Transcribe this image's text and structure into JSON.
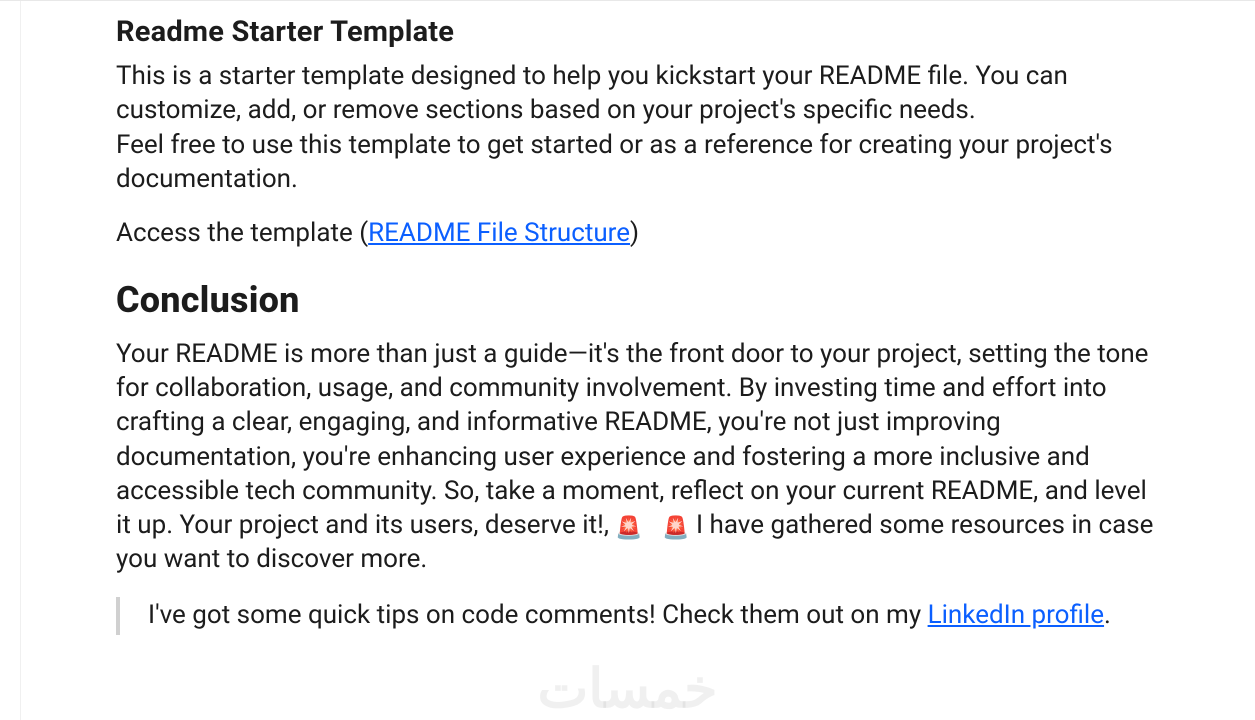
{
  "sections": {
    "starter": {
      "title": "Readme Starter Template",
      "para1": "This is a starter template designed to help you kickstart your README file. You can customize, add, or remove sections based on your project's specific needs.\nFeel free to use this template to get started or as a reference for creating your project's documentation.",
      "access_prefix": "Access the template (",
      "access_link": "README File Structure",
      "access_suffix": ")"
    },
    "conclusion": {
      "title": "Conclusion",
      "body_before": "Your README is more than just a guide—it's the front door to your project, setting the tone for collaboration, usage, and community involvement. By investing time and effort into crafting a clear, engaging, and informative README, you're not just improving documentation, you're enhancing user experience and fostering a more inclusive and accessible tech community. So, take a moment, reflect on your current README, and level it up. Your project and its users, deserve it!, ",
      "body_after": " I have gathered some resources in case you want to discover more.",
      "quote_before": "I've got some quick tips on code comments! Check them out on my ",
      "quote_link": "LinkedIn profile",
      "quote_after": "."
    }
  },
  "icons": {
    "siren": "🚨",
    "siren2": "🚨"
  },
  "watermark": "خمسات"
}
